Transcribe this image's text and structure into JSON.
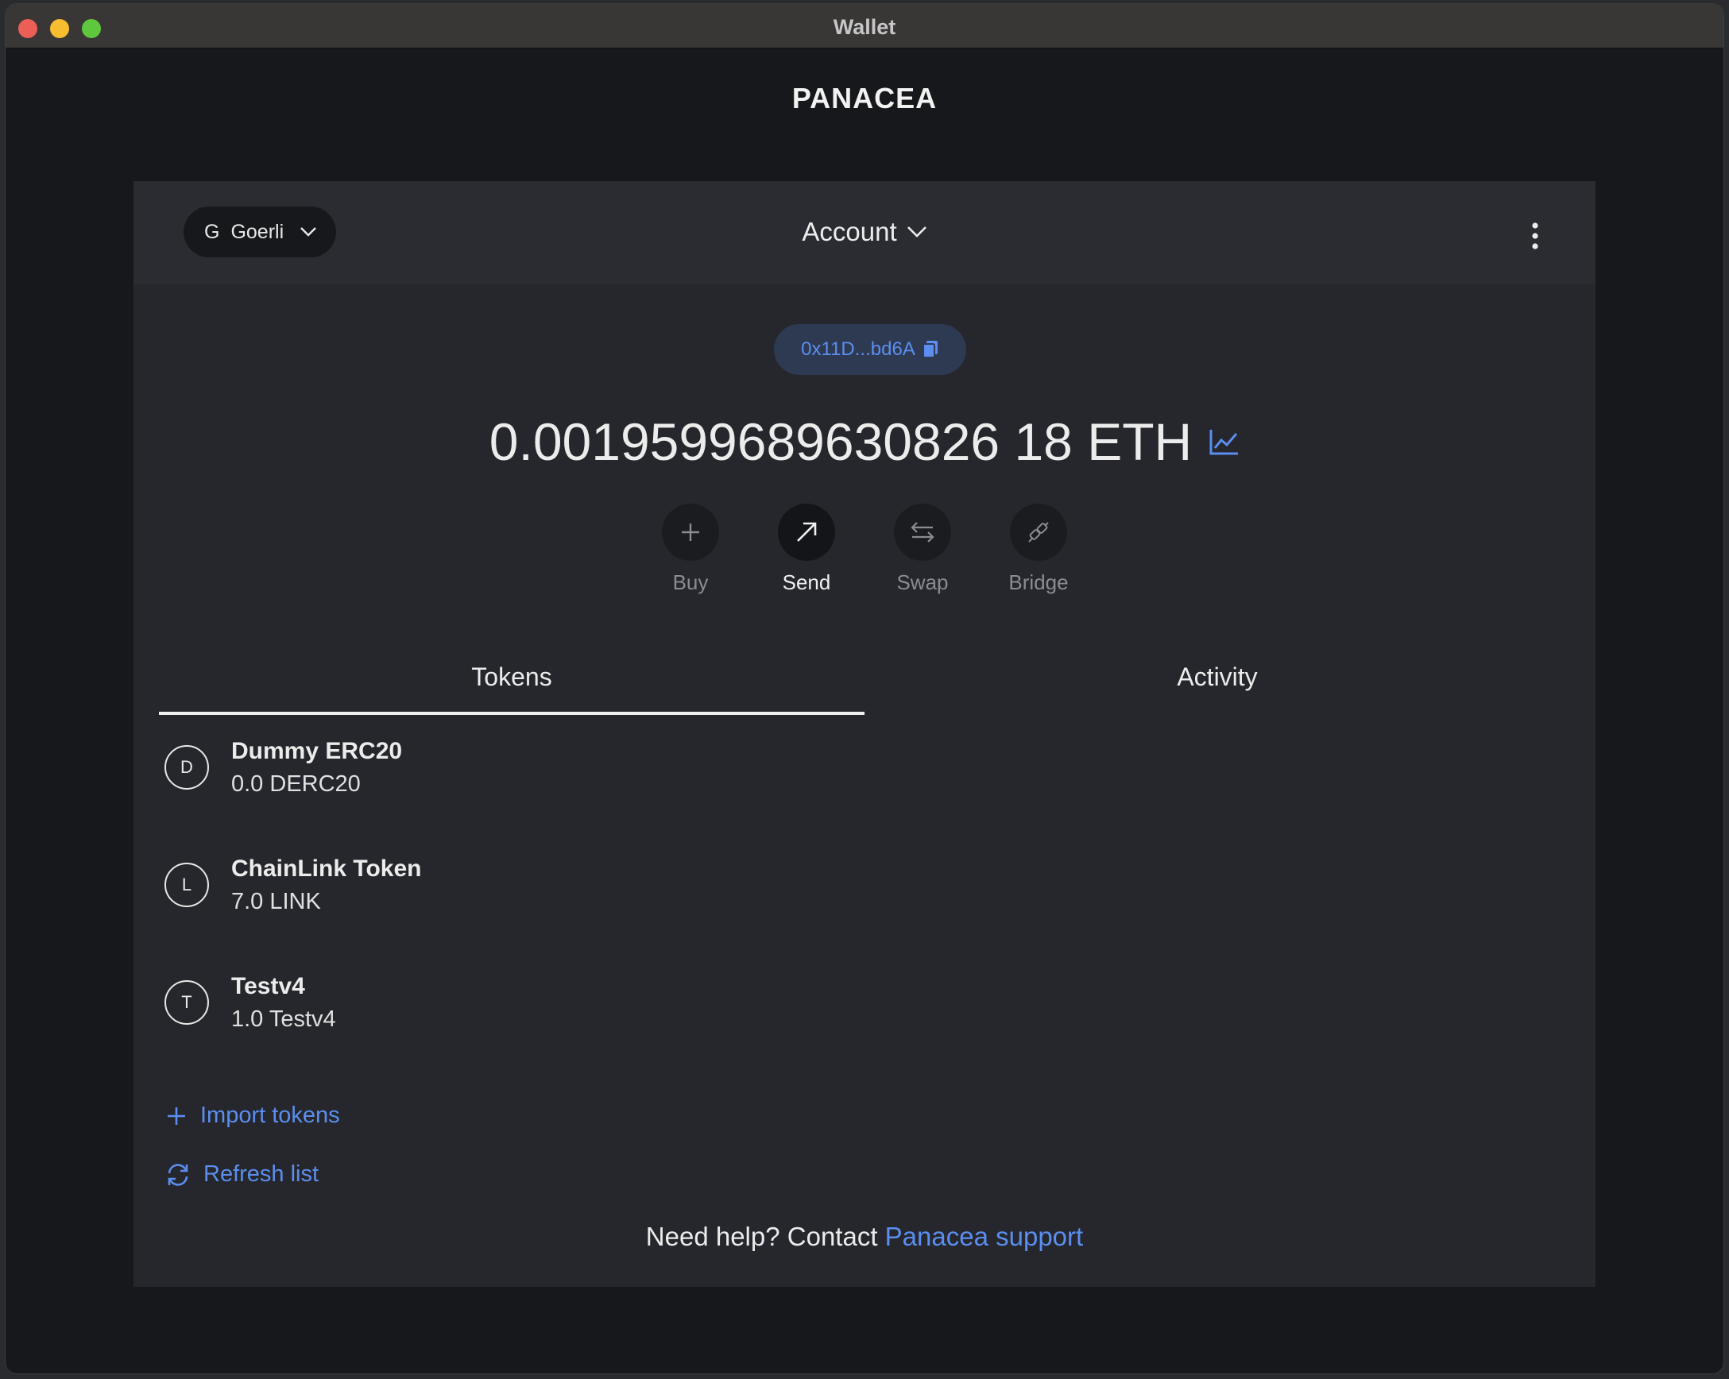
{
  "window": {
    "title": "Wallet"
  },
  "brand": "PANACEA",
  "header": {
    "network_badge": "G",
    "network_name": "Goerli",
    "account_label": "Account"
  },
  "address": "0x11D...bd6A",
  "balance": "0.0019599689630826 18 ETH",
  "actions": [
    {
      "label": "Buy",
      "icon": "plus-icon",
      "active": false
    },
    {
      "label": "Send",
      "icon": "arrow-up-right-icon",
      "active": true
    },
    {
      "label": "Swap",
      "icon": "swap-icon",
      "active": false
    },
    {
      "label": "Bridge",
      "icon": "bridge-icon",
      "active": false
    }
  ],
  "tabs": [
    {
      "label": "Tokens",
      "active": true
    },
    {
      "label": "Activity",
      "active": false
    }
  ],
  "tokens": [
    {
      "initial": "D",
      "name": "Dummy ERC20",
      "balance": "0.0 DERC20"
    },
    {
      "initial": "L",
      "name": "ChainLink Token",
      "balance": "7.0 LINK"
    },
    {
      "initial": "T",
      "name": "Testv4",
      "balance": "1.0 Testv4"
    }
  ],
  "links": {
    "import": "Import tokens",
    "refresh": "Refresh list"
  },
  "help": {
    "prefix": "Need help? Contact",
    "link": "Panacea support"
  },
  "colors": {
    "accent": "#5b8ef0",
    "panel": "#25272c",
    "background": "#17181b"
  }
}
